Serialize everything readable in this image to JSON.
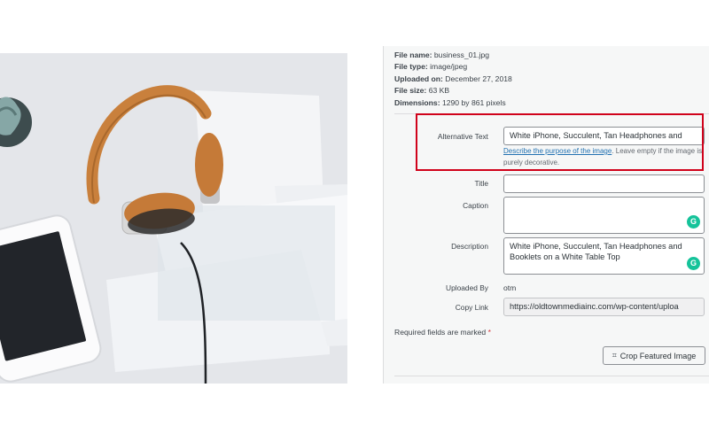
{
  "file_meta": [
    {
      "label": "File name:",
      "value": "business_01.jpg"
    },
    {
      "label": "File type:",
      "value": "image/jpeg"
    },
    {
      "label": "Uploaded on:",
      "value": "December 27, 2018"
    },
    {
      "label": "File size:",
      "value": "63 KB"
    },
    {
      "label": "Dimensions:",
      "value": "1290 by 861 pixels"
    }
  ],
  "alt_text": {
    "label": "Alternative Text",
    "value": "White iPhone, Succulent, Tan Headphones and",
    "help_link": "Describe the purpose of the image",
    "help_text": ". Leave empty if the image is purely decorative."
  },
  "title": {
    "label": "Title",
    "value": ""
  },
  "caption": {
    "label": "Caption",
    "value": ""
  },
  "description": {
    "label": "Description",
    "value": "White iPhone, Succulent, Tan Headphones and Booklets on a White Table Top"
  },
  "uploaded_by": {
    "label": "Uploaded By",
    "value": "otm"
  },
  "copy_link": {
    "label": "Copy Link",
    "value": "https://oldtownmediainc.com/wp-content/uploa"
  },
  "required_note": {
    "text": "Required fields are marked",
    "star": "*"
  },
  "crop_button": {
    "label": "Crop Featured Image",
    "icon": "crop-icon"
  },
  "grammarly_icon": "G",
  "colors": {
    "highlight": "#d0021b",
    "link": "#2271b1",
    "grammarly": "#15c39a"
  }
}
